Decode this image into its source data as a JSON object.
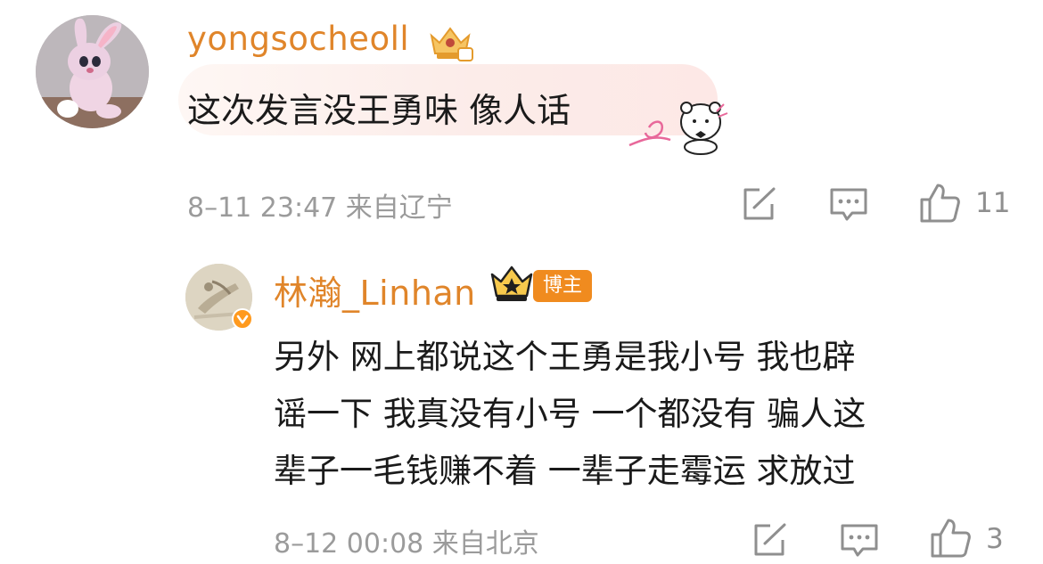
{
  "comments": [
    {
      "username": "yongsocheoll",
      "text": "这次发言没王勇味 像人话",
      "meta": "8–11 23:47 来自辽宁",
      "likes": "11"
    }
  ],
  "reply": {
    "username": "林瀚_Linhan",
    "tag": "博主",
    "lines": [
      "另外 网上都说这个王勇是我小号 我也辟",
      "谣一下 我真没有小号 一个都没有 骗人这",
      "辈子一毛钱赚不着 一辈子走霉运 求放过"
    ],
    "meta": "8–12 00:08 来自北京",
    "likes": "3"
  },
  "colors": {
    "username": "#e0852a",
    "meta_gray": "#9b9b9b",
    "icon_gray": "#8f8f8f",
    "tag_bg": "#f08b1f"
  },
  "icons": [
    "share-icon",
    "comment-icon",
    "like-icon",
    "crown-icon",
    "verified-icon",
    "bear-sticker"
  ]
}
